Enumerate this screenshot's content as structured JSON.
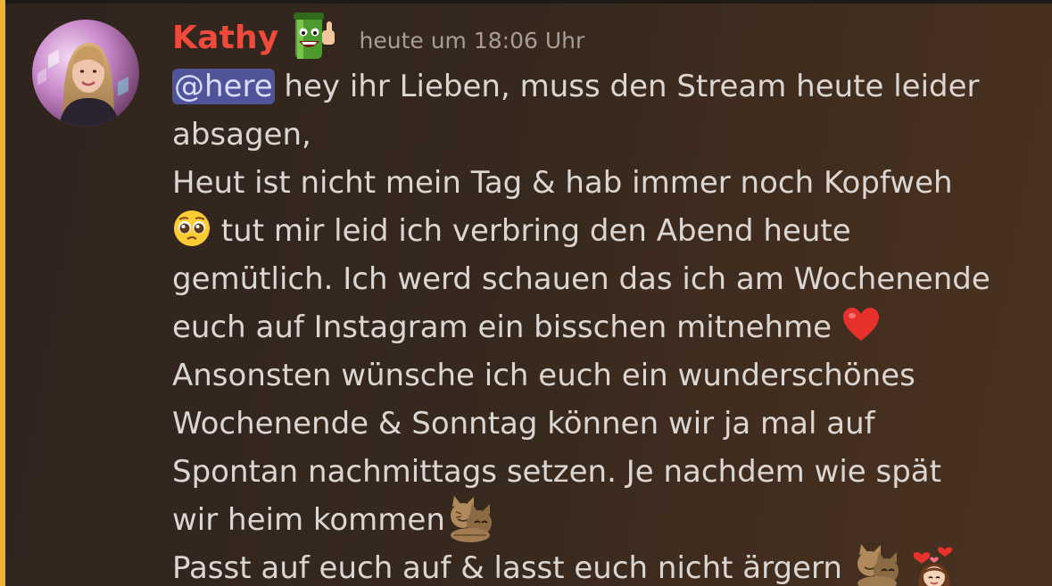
{
  "message": {
    "author": "Kathy",
    "author_color": "#f04a3c",
    "role_icon": "smiling-bottle-thumbs-up-icon",
    "timestamp": "heute um 18:06 Uhr",
    "mention": "@here",
    "mention_color": "#4f5499",
    "highlight_color": "#f0b232",
    "lines": [
      " hey ihr Lieben, muss den Stream heute leider",
      "absagen,",
      "Heut ist nicht mein Tag & hab immer noch Kopfweh",
      " tut mir leid ich verbring den Abend heute",
      "gemütlich. Ich werd schauen das ich am Wochenende",
      "euch auf Instagram ein bisschen mitnehme ",
      "Ansonsten wünsche ich euch ein wunderschönes",
      "Wochenende & Sonntag können wir ja mal auf",
      "Spontan nachmittags setzen. Je nachdem wie spät",
      "wir heim kommen",
      "Passt auf euch auf & lasst euch nicht ärgern "
    ],
    "emojis": {
      "pleading": "pleading-face-icon",
      "heart": "red-heart-icon",
      "cats": "hugging-cats-icon",
      "girl_hearts": "girl-with-hearts-icon"
    }
  }
}
